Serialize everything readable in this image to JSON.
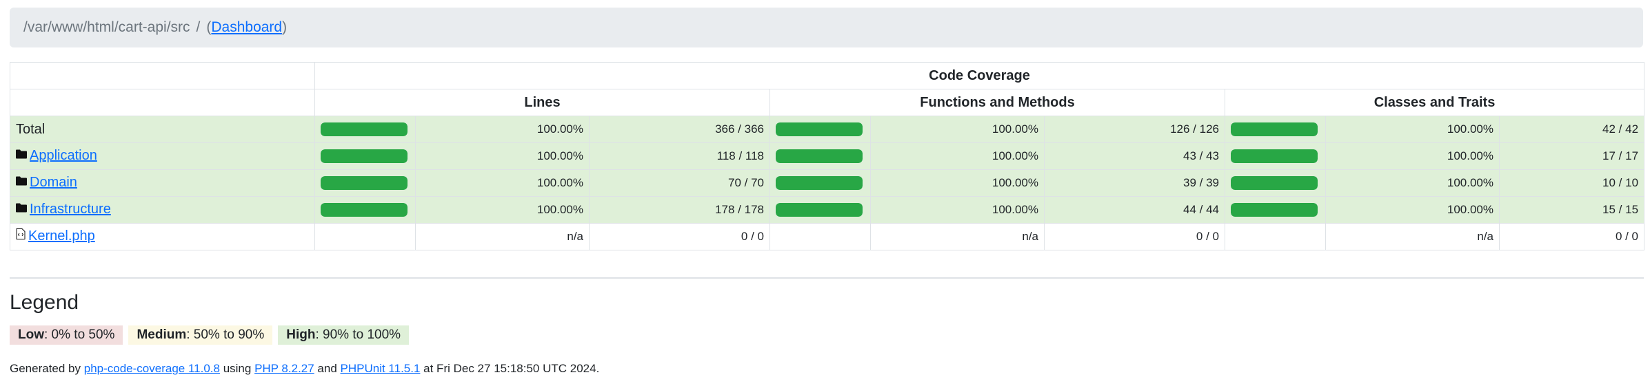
{
  "breadcrumb": {
    "path": "/var/www/html/cart-api/src",
    "separator": "/",
    "open_paren": "(",
    "dashboard_label": "Dashboard",
    "close_paren": ")"
  },
  "table": {
    "header_title": "Code Coverage",
    "columns": [
      "Lines",
      "Functions and Methods",
      "Classes and Traits"
    ],
    "rows": [
      {
        "name": "Total",
        "type": "total",
        "level": "high",
        "lines": {
          "bar": 1.0,
          "pct": "100.00%",
          "ratio": "366 / 366"
        },
        "functions": {
          "bar": 1.0,
          "pct": "100.00%",
          "ratio": "126 / 126"
        },
        "classes": {
          "bar": 1.0,
          "pct": "100.00%",
          "ratio": "42 / 42"
        }
      },
      {
        "name": "Application",
        "type": "directory",
        "level": "high",
        "lines": {
          "bar": 1.0,
          "pct": "100.00%",
          "ratio": "118 / 118"
        },
        "functions": {
          "bar": 1.0,
          "pct": "100.00%",
          "ratio": "43 / 43"
        },
        "classes": {
          "bar": 1.0,
          "pct": "100.00%",
          "ratio": "17 / 17"
        }
      },
      {
        "name": "Domain",
        "type": "directory",
        "level": "high",
        "lines": {
          "bar": 1.0,
          "pct": "100.00%",
          "ratio": "70 / 70"
        },
        "functions": {
          "bar": 1.0,
          "pct": "100.00%",
          "ratio": "39 / 39"
        },
        "classes": {
          "bar": 1.0,
          "pct": "100.00%",
          "ratio": "10 / 10"
        }
      },
      {
        "name": "Infrastructure",
        "type": "directory",
        "level": "high",
        "lines": {
          "bar": 1.0,
          "pct": "100.00%",
          "ratio": "178 / 178"
        },
        "functions": {
          "bar": 1.0,
          "pct": "100.00%",
          "ratio": "44 / 44"
        },
        "classes": {
          "bar": 1.0,
          "pct": "100.00%",
          "ratio": "15 / 15"
        }
      },
      {
        "name": "Kernel.php",
        "type": "file",
        "level": "none",
        "lines": {
          "bar": null,
          "pct": "n/a",
          "ratio": "0 / 0"
        },
        "functions": {
          "bar": null,
          "pct": "n/a",
          "ratio": "0 / 0"
        },
        "classes": {
          "bar": null,
          "pct": "n/a",
          "ratio": "0 / 0"
        }
      }
    ]
  },
  "legend": {
    "title": "Legend",
    "low_label": "Low",
    "low_range": ": 0% to 50%",
    "medium_label": "Medium",
    "medium_range": ": 50% to 90%",
    "high_label": "High",
    "high_range": ": 90% to 100%"
  },
  "footer": {
    "prefix": "Generated by ",
    "tool_link": "php-code-coverage 11.0.8",
    "using": " using ",
    "php_link": "PHP 8.2.27",
    "and": " and ",
    "phpunit_link": "PHPUnit 11.5.1",
    "suffix": " at Fri Dec 27 15:18:50 UTC 2024."
  },
  "colors": {
    "high_bg": "#dff0d8",
    "bar_fill": "#28a745",
    "link": "#0d6efd",
    "low_bg": "#f2dede",
    "medium_bg": "#fcf8e3"
  },
  "icons": {
    "directory": "folder-icon",
    "file": "code-file-icon"
  }
}
